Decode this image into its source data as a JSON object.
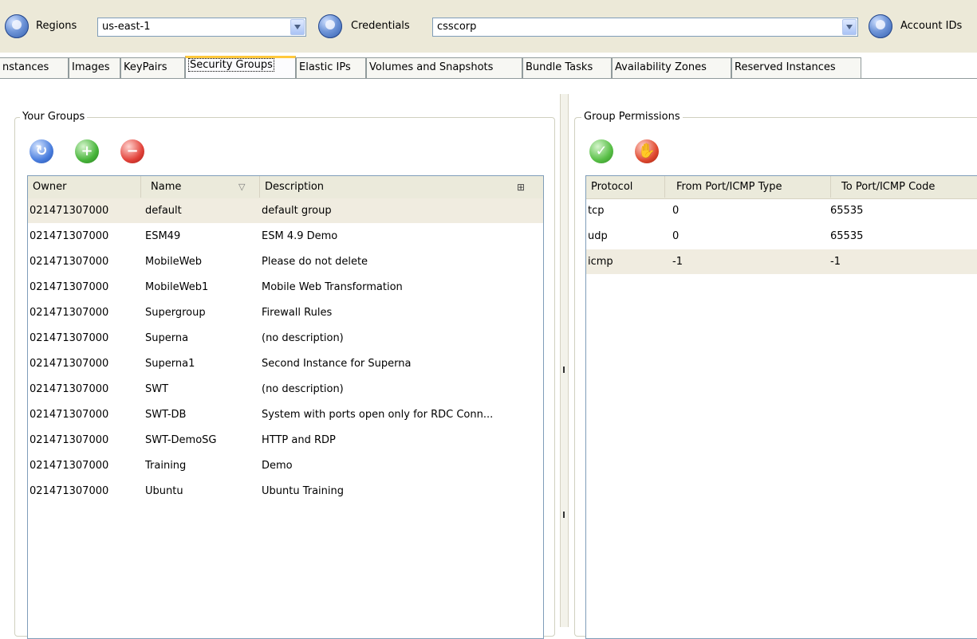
{
  "toolbar": {
    "regions_label": "Regions",
    "regions_value": "us-east-1",
    "credentials_label": "Credentials",
    "credentials_value": "csscorp",
    "account_ids_label": "Account IDs"
  },
  "tabs": [
    {
      "label": "nstances"
    },
    {
      "label": "Images"
    },
    {
      "label": "KeyPairs"
    },
    {
      "label": "Security Groups"
    },
    {
      "label": "Elastic IPs"
    },
    {
      "label": "Volumes and Snapshots"
    },
    {
      "label": "Bundle Tasks"
    },
    {
      "label": "Availability Zones"
    },
    {
      "label": "Reserved Instances"
    }
  ],
  "active_tab": "Security Groups",
  "groups_panel": {
    "title": "Your Groups",
    "toolbar_icons": [
      "refresh-icon",
      "add-icon",
      "remove-icon"
    ],
    "columns": [
      "Owner",
      "Name",
      "Description"
    ],
    "sort_indicator": "▽",
    "rows": [
      {
        "owner": "021471307000",
        "name": "default",
        "description": "default group"
      },
      {
        "owner": "021471307000",
        "name": "ESM49",
        "description": "ESM 4.9 Demo"
      },
      {
        "owner": "021471307000",
        "name": "MobileWeb",
        "description": "Please do not delete"
      },
      {
        "owner": "021471307000",
        "name": "MobileWeb1",
        "description": "Mobile Web Transformation"
      },
      {
        "owner": "021471307000",
        "name": "Supergroup",
        "description": "Firewall Rules"
      },
      {
        "owner": "021471307000",
        "name": "Superna",
        "description": "(no description)"
      },
      {
        "owner": "021471307000",
        "name": "Superna1",
        "description": "Second Instance for Superna"
      },
      {
        "owner": "021471307000",
        "name": "SWT",
        "description": "(no description)"
      },
      {
        "owner": "021471307000",
        "name": "SWT-DB",
        "description": "System with ports open only for RDC Conn..."
      },
      {
        "owner": "021471307000",
        "name": "SWT-DemoSG",
        "description": "HTTP and RDP"
      },
      {
        "owner": "021471307000",
        "name": "Training",
        "description": "Demo"
      },
      {
        "owner": "021471307000",
        "name": "Ubuntu",
        "description": "Ubuntu Training"
      }
    ]
  },
  "permissions_panel": {
    "title": "Group Permissions",
    "toolbar_icons": [
      "grant-icon",
      "revoke-icon"
    ],
    "columns": [
      "Protocol",
      "From Port/ICMP Type",
      "To Port/ICMP Code"
    ],
    "rows": [
      {
        "protocol": "tcp",
        "from": "0",
        "to": "65535"
      },
      {
        "protocol": "udp",
        "from": "0",
        "to": "65535"
      },
      {
        "protocol": "icmp",
        "from": "-1",
        "to": "-1"
      }
    ]
  },
  "colors": {
    "toolbar_bg": "#ece9d8",
    "selected_row": "#f0ece0",
    "active_tab_accent": "#ffc83c",
    "header_bg": "#ebeadb"
  }
}
